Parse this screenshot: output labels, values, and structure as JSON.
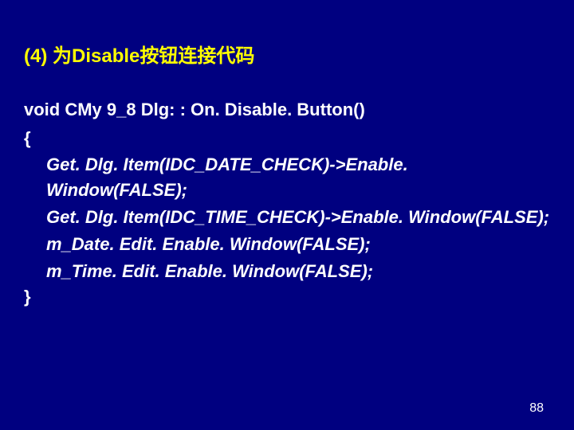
{
  "heading": "(4) 为Disable按钮连接代码",
  "signature": "void CMy 9_8 Dlg: : On. Disable. Button()",
  "open_brace": "{",
  "code_lines": [
    "Get. Dlg. Item(IDC_DATE_CHECK)->Enable. Window(FALSE);",
    "Get. Dlg. Item(IDC_TIME_CHECK)->Enable. Window(FALSE);",
    "m_Date. Edit. Enable. Window(FALSE);",
    "m_Time. Edit. Enable. Window(FALSE);"
  ],
  "close_brace": "}",
  "page_number": "88"
}
